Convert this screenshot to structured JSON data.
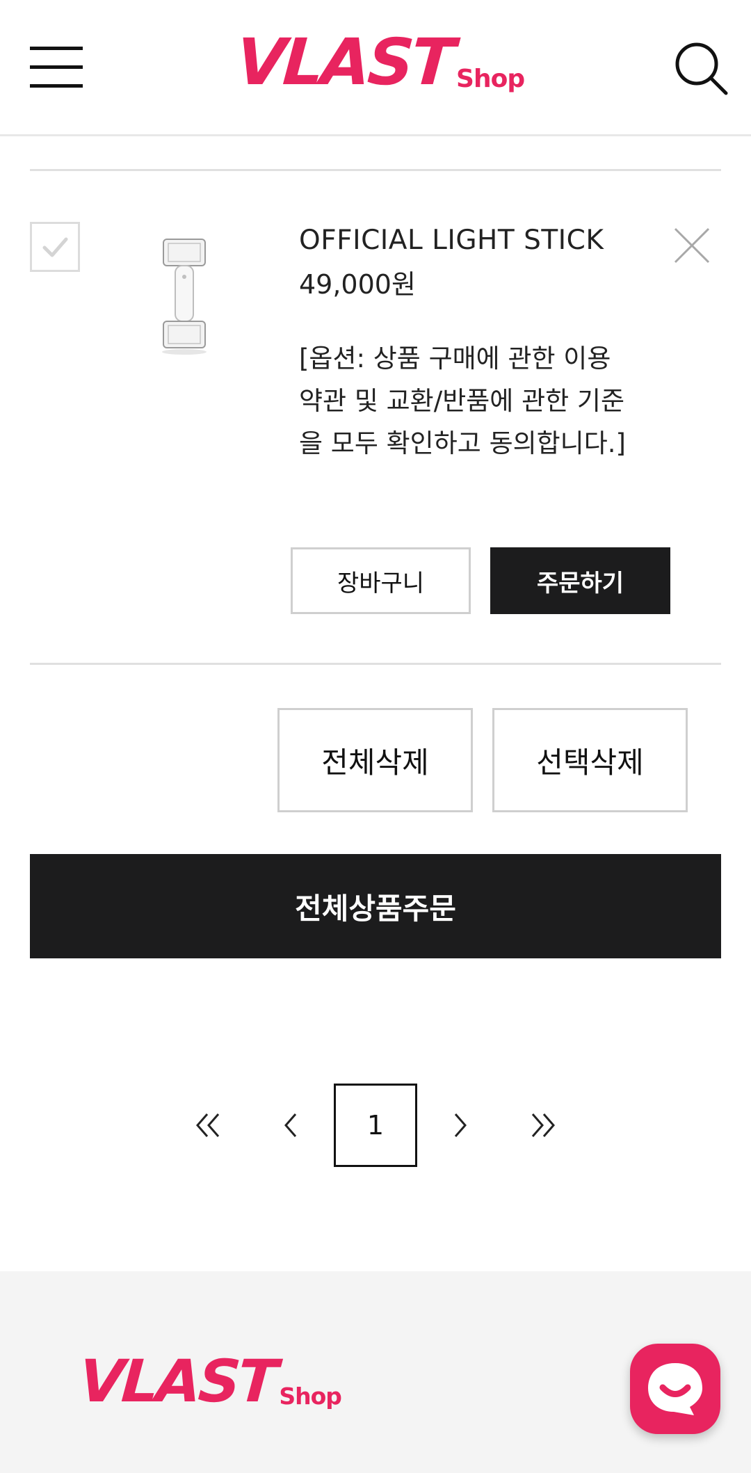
{
  "header": {
    "logo_main": "VLAST",
    "logo_sub": "Shop",
    "menu_icon": "hamburger-menu-icon",
    "search_icon": "search-icon"
  },
  "cart_item": {
    "checked_icon": "checkmark-icon",
    "image_alt": "light stick product image",
    "name": "OFFICIAL LIGHT STICK",
    "price": "49,000원",
    "option": "[옵션: 상품 구매에 관한 이용약관 및 교환/반품에 관한 기준을 모두 확인하고 동의합니다.]",
    "cart_button": "장바구니",
    "order_button": "주문하기",
    "remove_icon": "close-icon"
  },
  "actions": {
    "delete_all": "전체삭제",
    "delete_selected": "선택삭제",
    "order_all": "전체상품주문"
  },
  "pagination": {
    "current_page": "1",
    "first_icon": "double-chevron-left-icon",
    "prev_icon": "chevron-left-icon",
    "next_icon": "chevron-right-icon",
    "last_icon": "double-chevron-right-icon"
  },
  "footer": {
    "logo_main": "VLAST",
    "logo_sub": "Shop",
    "chat_icon": "chat-bubble-icon"
  },
  "colors": {
    "brand": "#e8245f",
    "dark_button": "#1c1c1d",
    "footer_bg": "#f4f4f4"
  }
}
